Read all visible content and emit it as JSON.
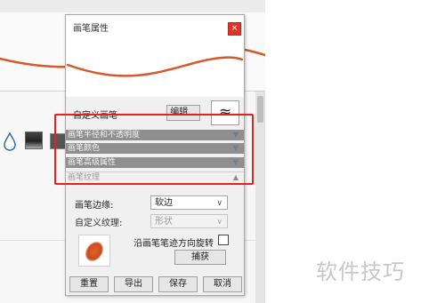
{
  "dialog": {
    "title": "画笔属性",
    "close_icon": "×",
    "custom_brush_label": "自定义画笔",
    "edit_button": "编辑...",
    "brush_shape_icon": "≈",
    "sections": [
      {
        "label": "画笔半径和不透明度",
        "state": "collapsed"
      },
      {
        "label": "画笔颜色",
        "state": "collapsed"
      },
      {
        "label": "画笔高级属性",
        "state": "collapsed"
      },
      {
        "label": "画笔纹理",
        "state": "expanded"
      }
    ],
    "edge_label": "画笔边缘:",
    "edge_value": "软边",
    "custom_texture_label": "自定义纹理:",
    "texture_value": "形状",
    "rotate_label": "沿画笔笔迹方向旋转",
    "rotate_checked": false,
    "capture_button": "捕获",
    "footer_buttons": [
      "重置",
      "导出",
      "保存",
      "取消"
    ]
  },
  "background_icons": [
    "water-drop-icon",
    "gradient-square-icon",
    "dark-square-icon"
  ],
  "highlight_color": "#e52222",
  "stroke_color": "#d4592c",
  "watermark": "软件技巧"
}
